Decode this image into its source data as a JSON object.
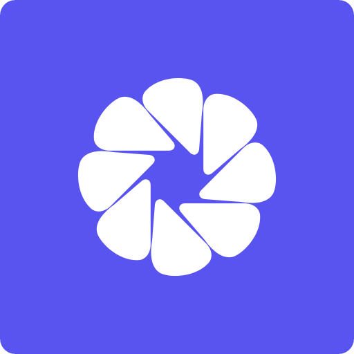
{
  "icon": {
    "name": "aperture-logo-icon",
    "background_color": "#5954F0",
    "glyph_color": "#FFFFFF",
    "blade_count": 8
  }
}
